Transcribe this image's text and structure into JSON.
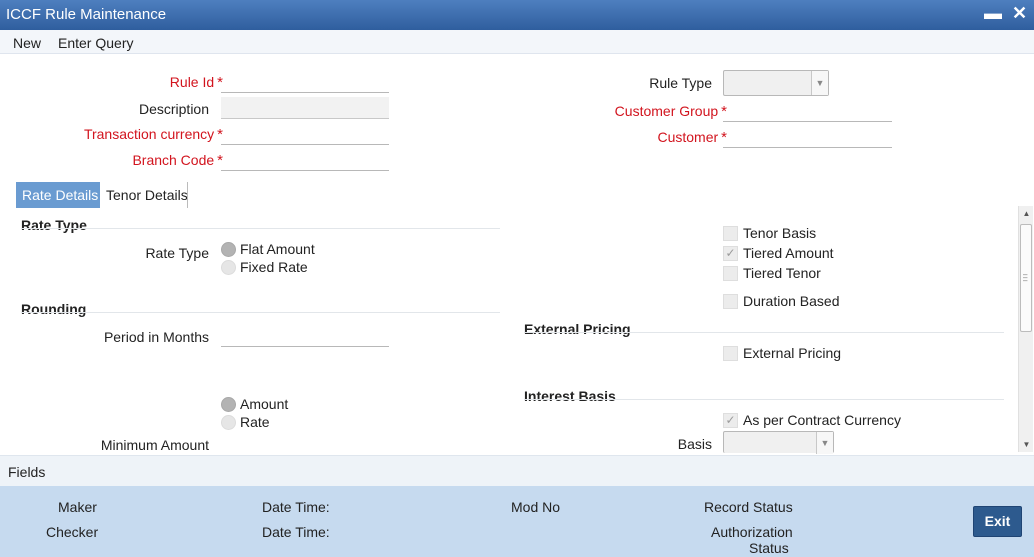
{
  "window": {
    "title": "ICCF Rule Maintenance",
    "minimize": "▬",
    "close": "✕"
  },
  "menu": {
    "new": "New",
    "enter_query": "Enter Query"
  },
  "header": {
    "rule_id": "Rule Id",
    "description": "Description",
    "transaction_currency": "Transaction currency",
    "branch_code": "Branch Code",
    "rule_type": "Rule Type",
    "customer_group": "Customer Group",
    "customer": "Customer",
    "required_mark": "*"
  },
  "tabs": {
    "rate_details": "Rate Details",
    "tenor_details": "Tenor Details"
  },
  "rate_type_section": {
    "heading": "Rate Type",
    "label": "Rate Type",
    "options": [
      "Flat Amount",
      "Fixed Rate"
    ],
    "selected": "Flat Amount"
  },
  "rounding_section": {
    "heading": "Rounding",
    "period_label": "Period in Months",
    "options": [
      "Amount",
      "Rate"
    ],
    "selected": "Amount",
    "minimum_amount": "Minimum Amount"
  },
  "basis_checks": [
    {
      "label": "Tenor Basis",
      "checked": false
    },
    {
      "label": "Tiered Amount",
      "checked": true
    },
    {
      "label": "Tiered Tenor",
      "checked": false
    },
    {
      "label": "Duration Based",
      "checked": false
    }
  ],
  "external_pricing_section": {
    "heading": "External Pricing",
    "checkbox": "External Pricing",
    "checked": false
  },
  "interest_basis_section": {
    "heading": "Interest Basis",
    "checkbox": "As per Contract Currency",
    "checked": true,
    "basis_label": "Basis"
  },
  "fields_bar": "Fields",
  "footer": {
    "maker": "Maker",
    "checker": "Checker",
    "date_time_1": "Date Time:",
    "date_time_2": "Date Time:",
    "mod_no": "Mod No",
    "record_status": "Record Status",
    "authorization_line1": "Authorization",
    "authorization_line2": "Status",
    "exit": "Exit"
  },
  "colors": {
    "title_bar": "#2f5e9e",
    "required": "#d2141e",
    "active_tab": "#6a9bd1",
    "footer": "#c6daef",
    "exit_button": "#2d5a8e"
  },
  "icons": {
    "dropdown": "chevron-down-icon",
    "scroll_up": "arrow-up-icon",
    "scroll_down": "arrow-down-icon"
  }
}
